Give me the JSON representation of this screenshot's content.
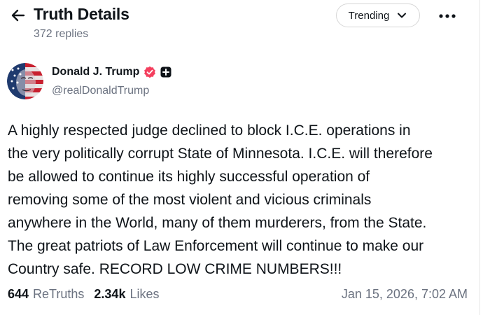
{
  "header": {
    "title": "Truth Details",
    "reply_count": "372 replies",
    "sort_label": "Trending"
  },
  "author": {
    "name": "Donald J. Trump",
    "handle": "@realDonaldTrump",
    "verified_color": "#f43f5e"
  },
  "post": {
    "text": "A highly respected judge declined to block I.C.E. operations in\nthe very politically corrupt State of Minnesota. I.C.E. will therefore\nbe allowed to continue its highly successful operation of\nremoving some of the most violent and vicious criminals\nanywhere in the World, many of them murderers, from the State.\nThe great patriots of Law Enforcement will continue to make our\nCountry safe. RECORD LOW CRIME NUMBERS!!!"
  },
  "stats": {
    "retruths_count": "644",
    "retruths_label": "ReTruths",
    "likes_count": "2.34k",
    "likes_label": "Likes",
    "timestamp": "Jan 15, 2026, 7:02 AM"
  },
  "icons": {
    "back": "arrow-left-icon",
    "sort": "chevron-down-icon",
    "more": "more-horizontal-icon",
    "verified": "verified-badge-icon",
    "plus": "plus-badge-icon"
  }
}
